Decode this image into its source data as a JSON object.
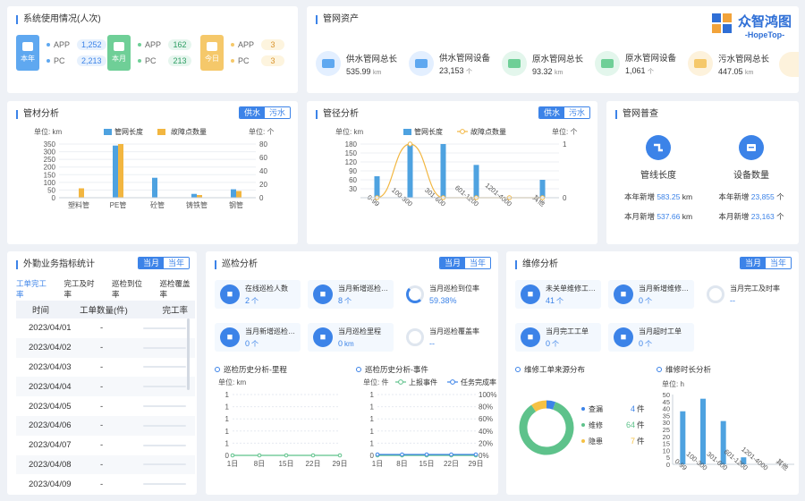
{
  "colors": {
    "accent": "#3c83e8",
    "length_bar": "#4ea2e0",
    "fault_bar": "#f2b640",
    "green": "#5ec28b",
    "yellow": "#f5c144"
  },
  "logo": {
    "cn": "众智鸿图",
    "en": "-HopeTop-"
  },
  "system_usage": {
    "title": "系统使用情况(人次)",
    "groups": [
      {
        "period": "本年",
        "app_label": "APP",
        "app_value": "1,252",
        "pc_label": "PC",
        "pc_value": "2,213",
        "color": "#5fa8f0"
      },
      {
        "period": "本月",
        "app_label": "APP",
        "app_value": "162",
        "pc_label": "PC",
        "pc_value": "213",
        "color": "#6fcf97"
      },
      {
        "period": "今日",
        "app_label": "APP",
        "app_value": "3",
        "pc_label": "PC",
        "pc_value": "3",
        "color": "#f5c86a"
      }
    ]
  },
  "pipe_assets": {
    "title": "管网资产",
    "items": [
      {
        "name": "供水管网总长",
        "value": "535.99",
        "unit": "km",
        "icon": "pipe-icon",
        "color": "#e3efff"
      },
      {
        "name": "供水管网设备",
        "value": "23,153",
        "unit": "个",
        "icon": "device-icon",
        "color": "#e3efff"
      },
      {
        "name": "原水管网总长",
        "value": "93.32",
        "unit": "km",
        "icon": "pipe-icon",
        "color": "#e3f6ec"
      },
      {
        "name": "原水管网设备",
        "value": "1,061",
        "unit": "个",
        "icon": "device-icon",
        "color": "#e3f6ec"
      },
      {
        "name": "污水管网总长",
        "value": "447.05",
        "unit": "km",
        "icon": "pipe-icon",
        "color": "#fdf2dc"
      }
    ]
  },
  "material_analysis": {
    "title": "管材分析",
    "toggle": [
      "供水",
      "污水"
    ],
    "left_unit": "单位: km",
    "right_unit": "单位: 个",
    "legend": [
      "管网长度",
      "故障点数量"
    ],
    "chart_data": {
      "type": "bar",
      "categories": [
        "塑料管",
        "PE管",
        "砼管",
        "铸铁管",
        "钢管"
      ],
      "series": [
        {
          "name": "管网长度",
          "values": [
            0,
            340,
            130,
            25,
            55
          ]
        },
        {
          "name": "故障点数量",
          "values": [
            14,
            80,
            0,
            4,
            10
          ]
        }
      ],
      "ylim_left": [
        0,
        350
      ],
      "yticks_left": [
        0,
        50,
        100,
        150,
        200,
        250,
        300,
        350
      ],
      "ylim_right": [
        0,
        80
      ],
      "yticks_right": [
        0,
        20,
        40,
        60,
        80
      ]
    }
  },
  "diameter_analysis": {
    "title": "管径分析",
    "toggle": [
      "供水",
      "污水"
    ],
    "left_unit": "单位: km",
    "right_unit": "单位: 个",
    "legend": [
      "管网长度",
      "故障点数量"
    ],
    "chart_data": {
      "type": "bar",
      "categories": [
        "0-99",
        "100-300",
        "301-600",
        "601-1200",
        "1201-4000",
        "其他"
      ],
      "series": [
        {
          "name": "管网长度",
          "values": [
            72,
            180,
            190,
            110,
            2,
            60
          ]
        },
        {
          "name": "故障点数量",
          "values": [
            0,
            1,
            0,
            0,
            0,
            0
          ]
        }
      ],
      "ylim_left": [
        0,
        180
      ],
      "yticks_left": [
        30,
        60,
        90,
        120,
        150,
        180
      ],
      "ylim_right": [
        0,
        1
      ],
      "yticks_right": [
        0,
        1
      ]
    }
  },
  "census": {
    "title": "管网普查",
    "left": {
      "label": "管线长度",
      "year_label": "本年新增",
      "year_value": "583.25",
      "year_unit": "km",
      "month_label": "本月新增",
      "month_value": "537.66",
      "month_unit": "km"
    },
    "right": {
      "label": "设备数量",
      "year_label": "本年新增",
      "year_value": "23,855",
      "year_unit": "个",
      "month_label": "本月新增",
      "month_value": "23,163",
      "month_unit": "个"
    }
  },
  "field_stats": {
    "title": "外勤业务指标统计",
    "toggle": [
      "当月",
      "当年"
    ],
    "tabs": [
      "工单完工率",
      "完工及时率",
      "巡检到位率",
      "巡检覆盖率"
    ],
    "columns": [
      "时间",
      "工单数量(件)",
      "完工率"
    ],
    "rows": [
      {
        "date": "2023/04/01",
        "count": "-"
      },
      {
        "date": "2023/04/02",
        "count": "-"
      },
      {
        "date": "2023/04/03",
        "count": "-"
      },
      {
        "date": "2023/04/04",
        "count": "-"
      },
      {
        "date": "2023/04/05",
        "count": "-"
      },
      {
        "date": "2023/04/06",
        "count": "-"
      },
      {
        "date": "2023/04/07",
        "count": "-"
      },
      {
        "date": "2023/04/08",
        "count": "-"
      },
      {
        "date": "2023/04/09",
        "count": "-"
      }
    ]
  },
  "inspection": {
    "title": "巡检分析",
    "toggle": [
      "当月",
      "当年"
    ],
    "cards": [
      {
        "label": "在线巡检人数",
        "value": "2",
        "unit": "个",
        "kind": "icon"
      },
      {
        "label": "当月新增巡检…",
        "value": "8",
        "unit": "个",
        "kind": "icon"
      },
      {
        "label": "当月巡检到位率",
        "value": "59.38%",
        "unit": "",
        "kind": "ring"
      },
      {
        "label": "当月新增巡检…",
        "value": "0",
        "unit": "个",
        "kind": "icon"
      },
      {
        "label": "当月巡检里程",
        "value": "0",
        "unit": "km",
        "kind": "icon"
      },
      {
        "label": "当月巡检覆盖率",
        "value": "--",
        "unit": "",
        "kind": "ring"
      }
    ],
    "mileage_title": "巡检历史分析-里程",
    "mileage_unit": "单位: km",
    "events_title": "巡检历史分析-事件",
    "events_unit": "单位: 件",
    "events_legend": [
      "上报事件",
      "任务完成率"
    ],
    "chart_data": [
      {
        "type": "line",
        "title": "巡检历史分析-里程",
        "x": [
          "1日",
          "8日",
          "15日",
          "22日",
          "29日"
        ],
        "series": [
          {
            "values": [
              0,
              0,
              0,
              0,
              0
            ]
          }
        ],
        "yticks": [
          0,
          1,
          1,
          1,
          1,
          1
        ]
      },
      {
        "type": "line",
        "title": "巡检历史分析-事件",
        "x": [
          "1日",
          "8日",
          "15日",
          "22日",
          "29日"
        ],
        "series": [
          {
            "name": "上报事件",
            "values": [
              0,
              0,
              0,
              0,
              0
            ]
          },
          {
            "name": "任务完成率",
            "values": [
              0,
              0,
              0,
              0,
              0
            ]
          }
        ],
        "yticks": [
          0,
          1,
          1,
          1,
          1,
          1
        ],
        "yticks_right": [
          "0%",
          "20%",
          "40%",
          "60%",
          "80%",
          "100%"
        ]
      }
    ]
  },
  "repair": {
    "title": "维修分析",
    "toggle": [
      "当月",
      "当年"
    ],
    "cards": [
      {
        "label": "未关单维修工…",
        "value": "41",
        "unit": "个",
        "kind": "icon"
      },
      {
        "label": "当月新增维修…",
        "value": "0",
        "unit": "个",
        "kind": "icon"
      },
      {
        "label": "当月完工及时率",
        "value": "--",
        "unit": "",
        "kind": "ring"
      },
      {
        "label": "当月完工工单",
        "value": "0",
        "unit": "个",
        "kind": "icon"
      },
      {
        "label": "当月超时工单",
        "value": "0",
        "unit": "个",
        "kind": "icon"
      }
    ],
    "source_title": "维修工单来源分布",
    "duration_title": "维修时长分析",
    "duration_unit": "单位: h",
    "chart_data": [
      {
        "type": "pie",
        "title": "维修工单来源分布",
        "categories": [
          "查漏",
          "维修",
          "隐患"
        ],
        "values": [
          4,
          64,
          7
        ],
        "unit": "件"
      },
      {
        "type": "bar",
        "title": "维修时长分析",
        "categories": [
          "0-99",
          "100-300",
          "301-600",
          "601-1200",
          "1201-4000",
          "其他"
        ],
        "values": [
          38,
          47,
          31,
          5,
          0,
          0
        ],
        "ylim": [
          0,
          50
        ],
        "yticks": [
          0,
          5,
          10,
          15,
          20,
          25,
          30,
          35,
          40,
          45,
          50
        ]
      }
    ]
  }
}
